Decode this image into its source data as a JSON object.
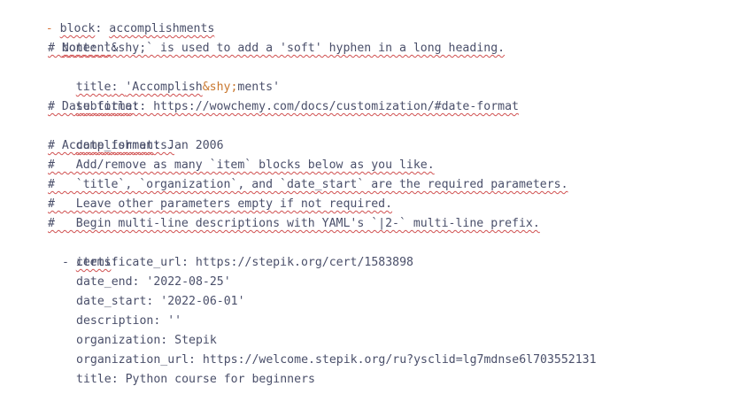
{
  "editor": {
    "lines": {
      "l1_dash": "- ",
      "l1_key": "block",
      "l1_sep": ": ",
      "l1_val": "accomplishments",
      "l2_key": "content",
      "l2_sep": ":",
      "l3": "# Note: `&shy;` is used to add a 'soft' hyphen in a long heading.",
      "l4_key": "title",
      "l4_sep": ": ",
      "l4_val1": "'Accomplish",
      "l4_ent": "&shy;",
      "l4_val2": "ments'",
      "l5_key": "subtitle",
      "l5_sep": ":",
      "l6": "# Date format: https://wowchemy.com/docs/customization/#date-format",
      "l7_key": "date_format",
      "l7_sep": ": ",
      "l7_val": "Jan 2006",
      "l8": "# Accomplishments.",
      "l9": "#   Add/remove as many `item` blocks below as you like.",
      "l10": "#   `title`, `organization`, and `date_start` are the required parameters.",
      "l11": "#   Leave other parameters empty if not required.",
      "l12": "#   Begin multi-line descriptions with YAML's `|2-` multi-line prefix.",
      "l13_key": "items",
      "l13_sep": ":",
      "l14": "- certificate_url: https://stepik.org/cert/1583898",
      "l15": "date_end: '2022-08-25'",
      "l16": "date_start: '2022-06-01'",
      "l17": "description: ''",
      "l18": "organization: Stepik",
      "l19": "organization_url: https://welcome.stepik.org/ru?ysclid=lg7mdnse6l703552131",
      "l20": "title: Python course for beginners"
    }
  }
}
